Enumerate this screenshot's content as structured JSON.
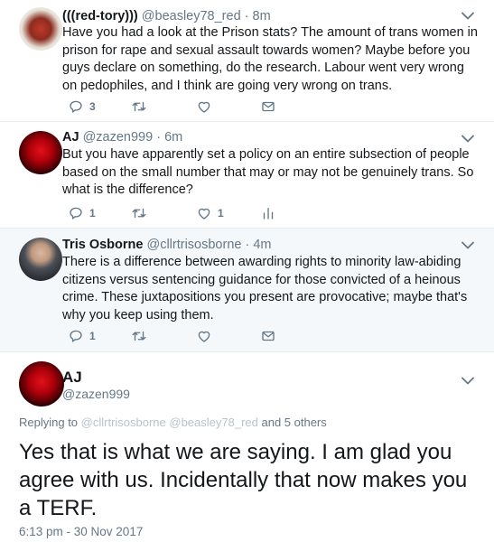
{
  "tweets": [
    {
      "name": "(((red-tory)))",
      "handle": "@beasley78_red",
      "time": " · 8m",
      "text": "Have you had a look at the Prison stats? The amount of trans women in prison for rape and sexual assault towards women? Maybe before you guys declare on something, do the research. Labour went very wrong on pedophiles, and I think are going very wrong on trans.",
      "reply_count": "3",
      "like_count": ""
    },
    {
      "name": "AJ",
      "handle": "@zazen999",
      "time": " · 6m",
      "text": "But you have apparently set a policy on an entire subsection of people based on the small number that may or may not be genuinely trans. So what is the difference?",
      "reply_count": "1",
      "like_count": "1"
    },
    {
      "name": "Tris Osborne",
      "handle": "@cllrtrisosborne",
      "time": " · 4m",
      "text": "There is a difference between awarding rights to minority law-abiding citizens versus sentencing guidance for those convicted of a heinous crime. These juxtapositions you present are provocative; maybe that's why you keep using them.",
      "reply_count": "1",
      "like_count": ""
    }
  ],
  "main_tweet": {
    "name": "AJ",
    "handle": "@zazen999",
    "replying_prefix": "Replying to ",
    "replying_handles": "@cllrtrisosborne @beasley78_red",
    "replying_suffix": " and 5 others",
    "text": "Yes that is what we are saying. I am glad you agree with us. Incidentally that now makes you a TERF.",
    "timestamp": "6:13 pm - 30 Nov 2017"
  },
  "colors": {
    "highlight_bg": "#f5f8fa",
    "icon_gray": "#657786",
    "divider": "#e6ecf0"
  },
  "icons": [
    "reply-icon",
    "retweet-icon",
    "like-icon",
    "message-icon",
    "analytics-icon",
    "chevron-down-icon"
  ]
}
